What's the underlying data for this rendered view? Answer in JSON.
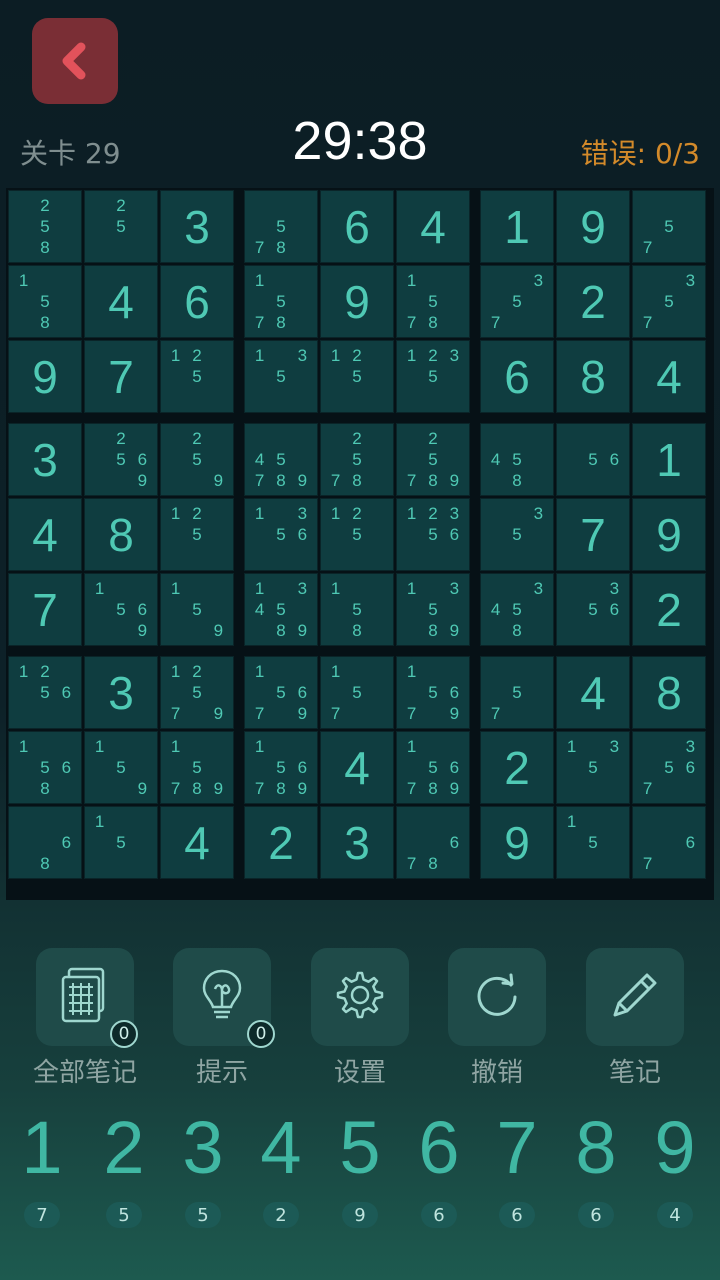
{
  "header": {
    "level_label": "关卡 29",
    "timer": "29:38",
    "errors_label": "错误: ",
    "errors_value": "0/3"
  },
  "colors": {
    "accent": "#4fc9b4",
    "back_button": "#7a2e35",
    "error": "#d38a2a"
  },
  "board": [
    [
      {
        "n": [
          2,
          5,
          8
        ]
      },
      {
        "n": [
          2,
          5
        ]
      },
      {
        "v": 3
      },
      {
        "n": [
          5,
          7,
          8
        ]
      },
      {
        "v": 6
      },
      {
        "v": 4
      },
      {
        "v": 1
      },
      {
        "v": 9
      },
      {
        "n": [
          5,
          7
        ]
      }
    ],
    [
      {
        "n": [
          1,
          5,
          8
        ]
      },
      {
        "v": 4
      },
      {
        "v": 6
      },
      {
        "n": [
          1,
          5,
          7,
          8
        ]
      },
      {
        "v": 9
      },
      {
        "n": [
          1,
          5,
          7,
          8
        ]
      },
      {
        "n": [
          3,
          5,
          7
        ]
      },
      {
        "v": 2
      },
      {
        "n": [
          3,
          5,
          7
        ]
      }
    ],
    [
      {
        "v": 9
      },
      {
        "v": 7
      },
      {
        "n": [
          1,
          2,
          5
        ]
      },
      {
        "n": [
          1,
          3,
          5
        ]
      },
      {
        "n": [
          1,
          2,
          5
        ]
      },
      {
        "n": [
          1,
          2,
          3,
          5
        ]
      },
      {
        "v": 6
      },
      {
        "v": 8
      },
      {
        "v": 4
      }
    ],
    [
      {
        "v": 3
      },
      {
        "n": [
          2,
          5,
          6,
          9
        ]
      },
      {
        "n": [
          2,
          5,
          9
        ]
      },
      {
        "n": [
          4,
          5,
          7,
          8,
          9
        ]
      },
      {
        "n": [
          2,
          5,
          7,
          8
        ]
      },
      {
        "n": [
          2,
          5,
          7,
          8,
          9
        ]
      },
      {
        "n": [
          4,
          5,
          8
        ]
      },
      {
        "n": [
          5,
          6
        ]
      },
      {
        "v": 1
      }
    ],
    [
      {
        "v": 4
      },
      {
        "v": 8
      },
      {
        "n": [
          1,
          2,
          5
        ]
      },
      {
        "n": [
          1,
          3,
          5,
          6
        ]
      },
      {
        "n": [
          1,
          2,
          5
        ]
      },
      {
        "n": [
          1,
          2,
          3,
          5,
          6
        ]
      },
      {
        "n": [
          3,
          5
        ]
      },
      {
        "v": 7
      },
      {
        "v": 9
      }
    ],
    [
      {
        "v": 7
      },
      {
        "n": [
          1,
          5,
          6,
          9
        ]
      },
      {
        "n": [
          1,
          5,
          9
        ]
      },
      {
        "n": [
          1,
          3,
          4,
          5,
          8,
          9
        ]
      },
      {
        "n": [
          1,
          5,
          8
        ]
      },
      {
        "n": [
          1,
          3,
          5,
          8,
          9
        ]
      },
      {
        "n": [
          3,
          4,
          5,
          8
        ]
      },
      {
        "n": [
          3,
          5,
          6
        ]
      },
      {
        "v": 2
      }
    ],
    [
      {
        "n": [
          1,
          2,
          5,
          6
        ]
      },
      {
        "v": 3
      },
      {
        "n": [
          1,
          2,
          5,
          7,
          9
        ]
      },
      {
        "n": [
          1,
          5,
          6,
          7,
          9
        ]
      },
      {
        "n": [
          1,
          5,
          7
        ]
      },
      {
        "n": [
          1,
          5,
          6,
          7,
          9
        ]
      },
      {
        "n": [
          5,
          7
        ]
      },
      {
        "v": 4
      },
      {
        "v": 8
      }
    ],
    [
      {
        "n": [
          1,
          5,
          6,
          8
        ]
      },
      {
        "n": [
          1,
          5,
          9
        ]
      },
      {
        "n": [
          1,
          5,
          7,
          8,
          9
        ]
      },
      {
        "n": [
          1,
          5,
          6,
          7,
          8,
          9
        ]
      },
      {
        "v": 4
      },
      {
        "n": [
          1,
          5,
          6,
          7,
          8,
          9
        ]
      },
      {
        "v": 2
      },
      {
        "n": [
          1,
          3,
          5
        ]
      },
      {
        "n": [
          3,
          5,
          6,
          7
        ]
      }
    ],
    [
      {
        "n": [
          6,
          8
        ]
      },
      {
        "n": [
          1,
          5
        ]
      },
      {
        "v": 4
      },
      {
        "v": 2
      },
      {
        "v": 3
      },
      {
        "n": [
          6,
          7,
          8
        ]
      },
      {
        "v": 9
      },
      {
        "n": [
          1,
          5
        ]
      },
      {
        "n": [
          6,
          7
        ]
      }
    ]
  ],
  "tools": [
    {
      "label": "全部笔记",
      "icon": "notes-grid-icon",
      "badge": "0"
    },
    {
      "label": "提示",
      "icon": "lightbulb-icon",
      "badge": "0"
    },
    {
      "label": "设置",
      "icon": "gear-icon"
    },
    {
      "label": "撤销",
      "icon": "undo-icon"
    },
    {
      "label": "笔记",
      "icon": "pencil-icon"
    }
  ],
  "numpad": [
    {
      "digit": "1",
      "count": "7"
    },
    {
      "digit": "2",
      "count": "5"
    },
    {
      "digit": "3",
      "count": "5"
    },
    {
      "digit": "4",
      "count": "2"
    },
    {
      "digit": "5",
      "count": "9"
    },
    {
      "digit": "6",
      "count": "6"
    },
    {
      "digit": "7",
      "count": "6"
    },
    {
      "digit": "8",
      "count": "6"
    },
    {
      "digit": "9",
      "count": "4"
    }
  ]
}
